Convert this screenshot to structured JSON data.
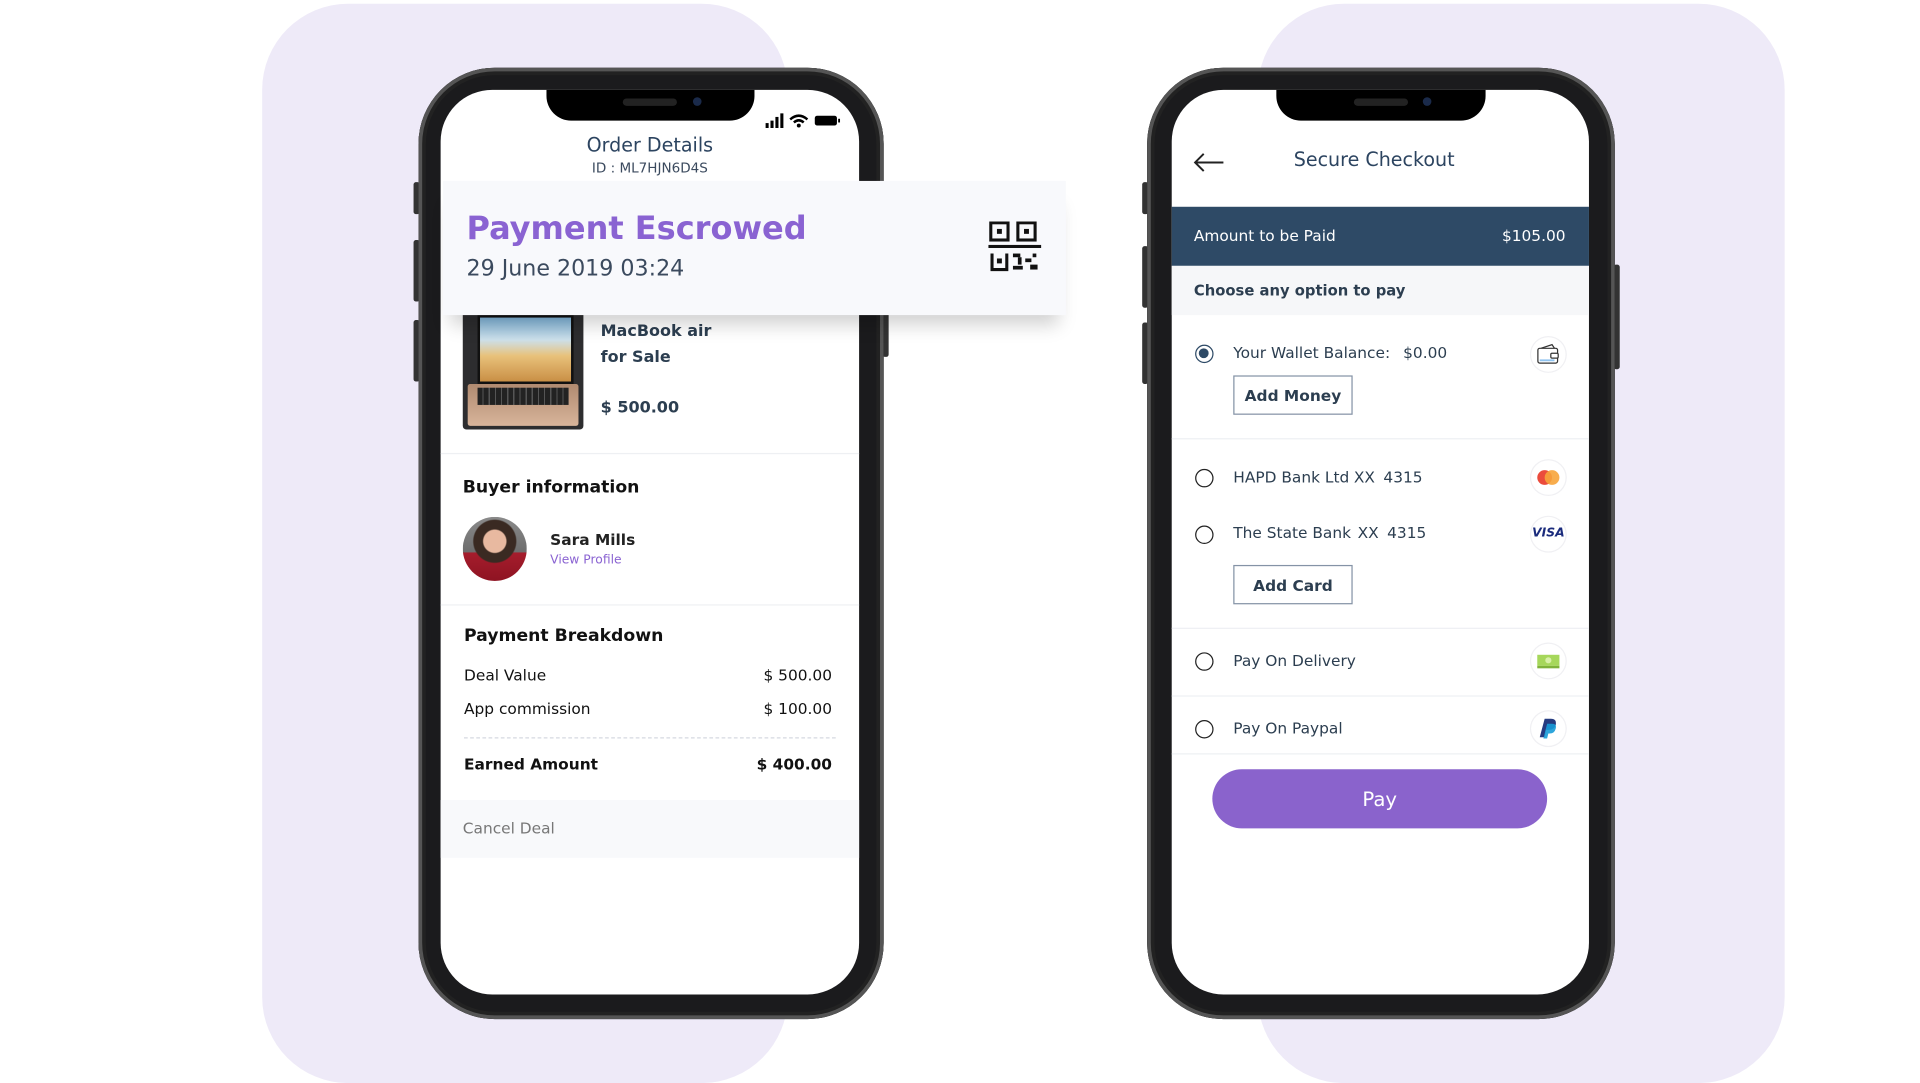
{
  "colors": {
    "accent": "#8a63d2",
    "navy": "#2e4a66",
    "background_blob": "#eeeaf8"
  },
  "order": {
    "title": "Order Details",
    "id": "ID : ML7HJN6D4S",
    "status": "Payment Escrowed",
    "date": "29 June 2019 03:24",
    "qr_icon": "qr-code-icon",
    "product": {
      "title_line1": "MacBook air",
      "title_line2": "for Sale",
      "price": "$ 500.00"
    },
    "buyer": {
      "heading": "Buyer information",
      "name": "Sara Mills",
      "link": "View Profile"
    },
    "breakdown": {
      "heading": "Payment Breakdown",
      "rows": [
        {
          "label": "Deal Value",
          "value": "$ 500.00"
        },
        {
          "label": "App commission",
          "value": "$ 100.00"
        }
      ],
      "total": {
        "label": "Earned Amount",
        "value": "$ 400.00"
      }
    },
    "cancel": "Cancel Deal"
  },
  "checkout": {
    "title": "Secure Checkout",
    "amount_label": "Amount to be Paid",
    "amount_value": "$105.00",
    "choose_label": "Choose any option to pay",
    "wallet": {
      "label": "Your Wallet Balance:",
      "value": "$0.00",
      "button": "Add Money",
      "selected": true,
      "icon": "wallet-icon"
    },
    "cards": [
      {
        "bank": "HAPD Bank Ltd",
        "mask": "XX",
        "last4": "4315",
        "icon": "mastercard-icon",
        "selected": false
      },
      {
        "bank": "The State Bank",
        "mask": "XX",
        "last4": "4315",
        "icon": "visa-icon",
        "selected": false
      }
    ],
    "visa_text": "VISA",
    "add_card": "Add Card",
    "delivery": {
      "label": "Pay On Delivery",
      "icon": "cash-icon",
      "selected": false
    },
    "paypal": {
      "label": "Pay On Paypal",
      "icon": "paypal-icon",
      "selected": false
    },
    "pay_button": "Pay"
  }
}
